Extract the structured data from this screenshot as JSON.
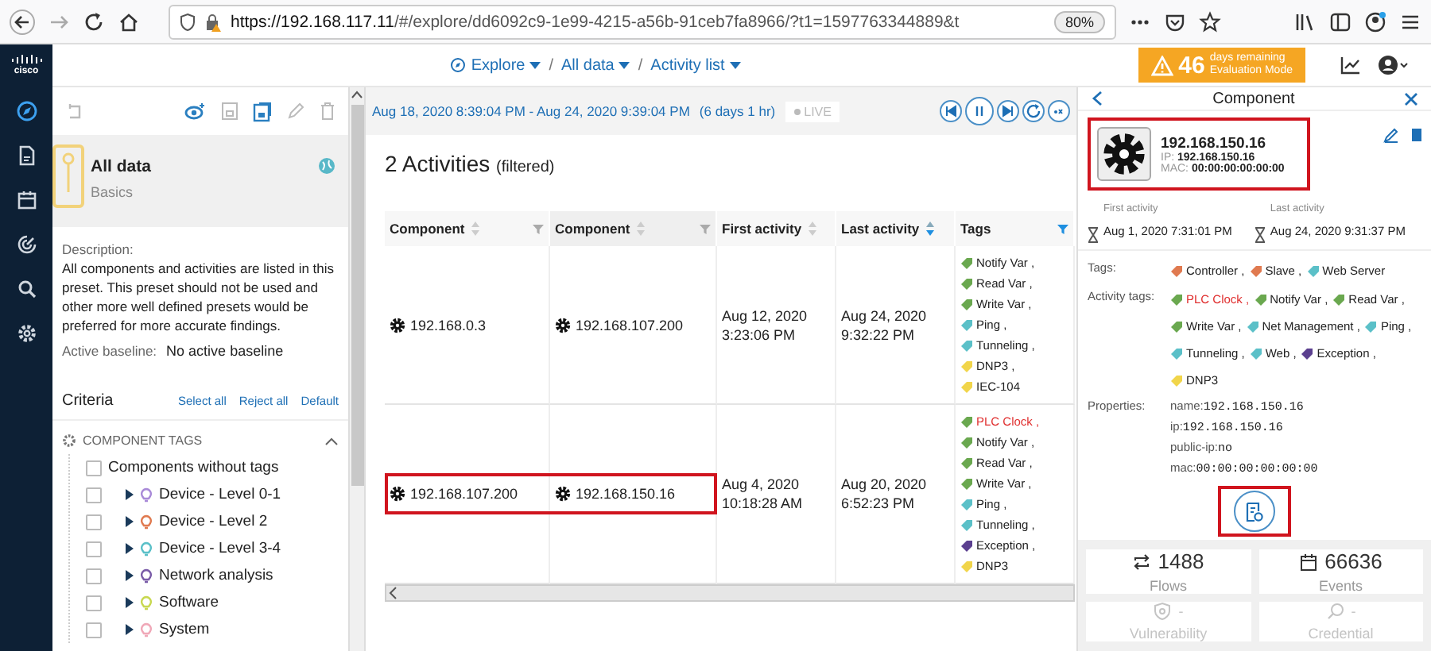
{
  "browser": {
    "url_host": "https://192.168.117.11",
    "url_path": "/#/explore/dd6092c9-1e99-4215-a56b-91ceb7fa8966/?t1=1597763344889&t",
    "zoom": "80%"
  },
  "header": {
    "logo": "cisco",
    "separator": "/",
    "breadcrumbs": [
      {
        "label": "Explore"
      },
      {
        "label": "All data"
      },
      {
        "label": "Activity list"
      }
    ],
    "trial": {
      "days": "46",
      "line1": "days remaining",
      "line2": "Evaluation Mode"
    }
  },
  "nav": [
    {
      "kind": "explore",
      "selected": true
    },
    {
      "kind": "report",
      "selected": false
    },
    {
      "kind": "calendar",
      "selected": false
    },
    {
      "kind": "radar",
      "selected": false
    },
    {
      "kind": "search",
      "selected": false
    },
    {
      "kind": "settings",
      "selected": false
    }
  ],
  "preset": {
    "title": "All data",
    "subtitle": "Basics",
    "description_label": "Description:",
    "description": "All components and activities are listed in this preset. This preset should not be used and other more well defined presets would be preferred for more accurate findings.",
    "baseline_label": "Active baseline:",
    "baseline": "No active baseline"
  },
  "criteria": {
    "title": "Criteria",
    "actions": [
      "Select all",
      "Reject all",
      "Default"
    ],
    "section": "COMPONENT TAGS",
    "expanded": true,
    "items": [
      {
        "kind": "plain",
        "label": "Components without tags",
        "checked": false
      },
      {
        "kind": "group",
        "label": "Device - Level 0-1",
        "color": "#a98ad8",
        "checked": false,
        "expanded": false
      },
      {
        "kind": "group",
        "label": "Device - Level 2",
        "color": "#e07a50",
        "checked": false,
        "expanded": false
      },
      {
        "kind": "group",
        "label": "Device - Level 3-4",
        "color": "#5bc0c8",
        "checked": false,
        "expanded": false
      },
      {
        "kind": "group",
        "label": "Network analysis",
        "color": "#7a5ca8",
        "checked": false,
        "expanded": false
      },
      {
        "kind": "group",
        "label": "Software",
        "color": "#c8d850",
        "checked": false,
        "expanded": false
      },
      {
        "kind": "group",
        "label": "System",
        "color": "#f0a8b8",
        "checked": false,
        "expanded": false
      }
    ]
  },
  "timeline": {
    "range": "Aug 18, 2020 8:39:04 PM - Aug 24, 2020 9:39:04 PM",
    "duration": "(6 days 1 hr)",
    "live": "LIVE",
    "live_on": false,
    "controls": [
      {
        "kind": "previous"
      },
      {
        "kind": "pause"
      },
      {
        "kind": "next"
      },
      {
        "kind": "refresh"
      },
      {
        "kind": "speed"
      }
    ]
  },
  "activities": {
    "count_title": "2 Activities",
    "filter_note": "(filtered)",
    "columns": [
      {
        "label": "Component",
        "sorted": false,
        "filtered": false
      },
      {
        "label": "Component",
        "sorted": false,
        "filtered": false
      },
      {
        "label": "First activity",
        "sorted": false
      },
      {
        "label": "Last activity",
        "sorted": true
      },
      {
        "label": "Tags",
        "filtered": true
      }
    ],
    "rows": [
      {
        "highlighted": false,
        "source": "192.168.0.3",
        "target": "192.168.107.200",
        "first_activity": "Aug 12, 2020 3:23:06 PM",
        "last_activity": "Aug 24, 2020 9:32:22 PM",
        "tags": [
          {
            "label": "Notify Var ,",
            "color": "#6aa84f",
            "alert": false
          },
          {
            "label": "Read Var ,",
            "color": "#6aa84f",
            "alert": false
          },
          {
            "label": "Write Var ,",
            "color": "#6aa84f",
            "alert": false
          },
          {
            "label": "Ping ,",
            "color": "#5bc0c8",
            "alert": false
          },
          {
            "label": "Tunneling ,",
            "color": "#5bc0c8",
            "alert": false
          },
          {
            "label": "DNP3 ,",
            "color": "#f1d54a",
            "alert": false
          },
          {
            "label": "IEC-104",
            "color": "#f1d54a",
            "alert": false
          }
        ]
      },
      {
        "highlighted": true,
        "source": "192.168.107.200",
        "target": "192.168.150.16",
        "first_activity": "Aug 4, 2020 10:18:28 AM",
        "last_activity": "Aug 20, 2020 6:52:23 PM",
        "tags": [
          {
            "label": "PLC Clock ,",
            "color": "#6aa84f",
            "alert": true
          },
          {
            "label": "Notify Var ,",
            "color": "#6aa84f",
            "alert": false
          },
          {
            "label": "Read Var ,",
            "color": "#6aa84f",
            "alert": false
          },
          {
            "label": "Write Var ,",
            "color": "#6aa84f",
            "alert": false
          },
          {
            "label": "Ping ,",
            "color": "#5bc0c8",
            "alert": false
          },
          {
            "label": "Tunneling ,",
            "color": "#5bc0c8",
            "alert": false
          },
          {
            "label": "Exception ,",
            "color": "#5b3f8f",
            "alert": false
          },
          {
            "label": "DNP3",
            "color": "#f1d54a",
            "alert": false
          }
        ]
      }
    ]
  },
  "component": {
    "title": "Component",
    "highlighted": true,
    "name": "192.168.150.16",
    "ip_label": "IP:",
    "ip": "192.168.150.16",
    "mac_label": "MAC:",
    "mac": "00:00:00:00:00:00",
    "first_label": "First activity",
    "first": "Aug 1, 2020 7:31:01 PM",
    "last_label": "Last activity",
    "last": "Aug 24, 2020 9:31:37 PM",
    "tags_label": "Tags:",
    "tags": [
      {
        "label": "Controller ,",
        "color": "#e07a50",
        "alert": false
      },
      {
        "label": "Slave ,",
        "color": "#e07a50",
        "alert": false
      },
      {
        "label": "Web Server",
        "color": "#5bc0c8",
        "alert": false
      }
    ],
    "activity_tags_label": "Activity tags:",
    "activity_tags": [
      {
        "label": "PLC Clock ,",
        "color": "#6aa84f",
        "alert": true
      },
      {
        "label": "Notify Var ,",
        "color": "#6aa84f",
        "alert": false
      },
      {
        "label": "Read Var ,",
        "color": "#6aa84f",
        "alert": false
      },
      {
        "label": "Write Var ,",
        "color": "#6aa84f",
        "alert": false
      },
      {
        "label": "Net Management ,",
        "color": "#5bc0c8",
        "alert": false
      },
      {
        "label": "Ping ,",
        "color": "#5bc0c8",
        "alert": false
      },
      {
        "label": "Tunneling ,",
        "color": "#5bc0c8",
        "alert": false
      },
      {
        "label": "Web ,",
        "color": "#5bc0c8",
        "alert": false
      },
      {
        "label": "Exception ,",
        "color": "#5b3f8f",
        "alert": false
      },
      {
        "label": "DNP3",
        "color": "#f1d54a",
        "alert": false
      }
    ],
    "properties_label": "Properties:",
    "properties": [
      {
        "key": "name:",
        "value": "192.168.150.16"
      },
      {
        "key": "ip:",
        "value": "192.168.150.16"
      },
      {
        "key": "public-ip:",
        "value": "no"
      },
      {
        "key": "mac:",
        "value": "00:00:00:00:00:00"
      }
    ],
    "report_highlighted": true,
    "stats": [
      {
        "kind": "flows",
        "value": "1488",
        "label": "Flows",
        "disabled": false
      },
      {
        "kind": "events",
        "value": "66636",
        "label": "Events",
        "disabled": false
      },
      {
        "kind": "vulnerability",
        "value": "-",
        "label": "Vulnerability",
        "disabled": true
      },
      {
        "kind": "credential",
        "value": "-",
        "label": "Credential",
        "disabled": true
      }
    ]
  }
}
